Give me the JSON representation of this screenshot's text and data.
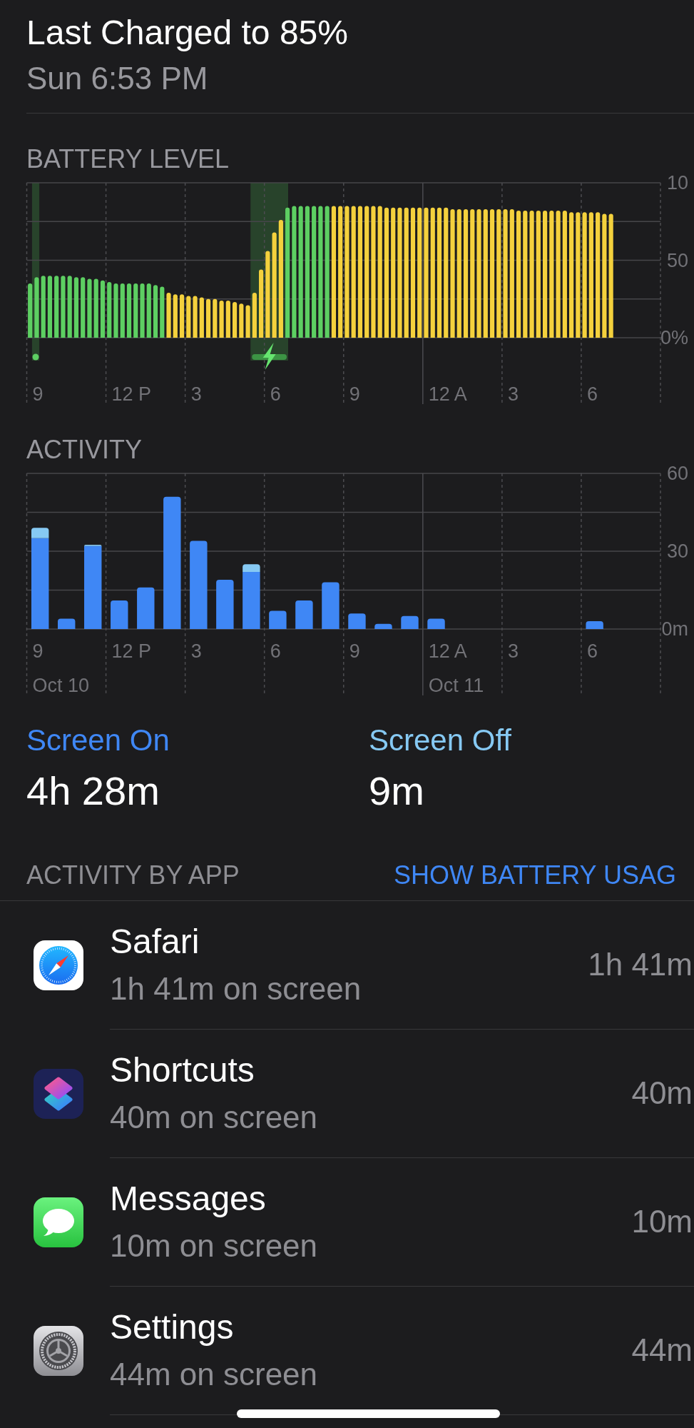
{
  "header": {
    "title": "Last Charged to 85%",
    "subtitle": "Sun 6:53 PM"
  },
  "battery_level": {
    "heading": "BATTERY LEVEL",
    "y_top_label": "10",
    "x_labels": [
      {
        "label": "9"
      },
      {
        "label": "12 P"
      },
      {
        "label": "3"
      },
      {
        "label": "6"
      },
      {
        "label": "9"
      },
      {
        "label": "12 A"
      },
      {
        "label": "3"
      },
      {
        "label": "6"
      }
    ],
    "chart_data": {
      "type": "bar",
      "ylim": [
        0,
        100
      ],
      "yticks": [
        {
          "value": 0,
          "label": "0%"
        },
        50
      ],
      "series": [
        {
          "color": "#5dcf62",
          "values": [
            35,
            39,
            40,
            40,
            40,
            40,
            40,
            39,
            39,
            38,
            38,
            37,
            36,
            35,
            35,
            35,
            35,
            35,
            35,
            34,
            33,
            null,
            null,
            null,
            null,
            null,
            null,
            null,
            null,
            null,
            null,
            null,
            null,
            null,
            null,
            null,
            null,
            null,
            null,
            84,
            85,
            85,
            85,
            85,
            85,
            85,
            null,
            null,
            null,
            null,
            null,
            null,
            null,
            null,
            null,
            null,
            null,
            null,
            null,
            null,
            null,
            null,
            null,
            null,
            null,
            null,
            null,
            null,
            null,
            null,
            null,
            null,
            null,
            null,
            null,
            null,
            null,
            null,
            null,
            null,
            null,
            null,
            null,
            null,
            null,
            null,
            null,
            null,
            null,
            null,
            null,
            null,
            null,
            null,
            null,
            null
          ]
        },
        {
          "color": "#f4d13d",
          "values": [
            null,
            null,
            null,
            null,
            null,
            null,
            null,
            null,
            null,
            null,
            null,
            null,
            null,
            null,
            null,
            null,
            null,
            null,
            null,
            null,
            null,
            29,
            28,
            28,
            27,
            27,
            26,
            25,
            25,
            24,
            24,
            23,
            22,
            21,
            29,
            44,
            56,
            68,
            76,
            null,
            null,
            null,
            null,
            null,
            null,
            null,
            85,
            85,
            85,
            85,
            85,
            85,
            85,
            85,
            84,
            84,
            84,
            84,
            84,
            84,
            84,
            84,
            84,
            84,
            83,
            83,
            83,
            83,
            83,
            83,
            83,
            83,
            83,
            83,
            82,
            82,
            82,
            82,
            82,
            82,
            82,
            82,
            81,
            81,
            81,
            81,
            81,
            80,
            80,
            null,
            null,
            null,
            null,
            null,
            null,
            null
          ]
        }
      ]
    }
  },
  "activity": {
    "heading": "ACTIVITY",
    "x_labels": [
      {
        "label": "9",
        "date": "Oct 10"
      },
      {
        "label": "12 P"
      },
      {
        "label": "3"
      },
      {
        "label": "6"
      },
      {
        "label": "9"
      },
      {
        "label": "12 A",
        "date": "Oct 11"
      },
      {
        "label": "3"
      },
      {
        "label": "6"
      }
    ],
    "chart_data": {
      "type": "bar",
      "stacked": true,
      "ylim": [
        0,
        60
      ],
      "yticks": [
        {
          "value": 0,
          "label": "0m"
        },
        30,
        60
      ],
      "series": [
        {
          "color": "#3f87f5",
          "values": [
            35,
            4,
            32,
            11,
            16,
            51,
            34,
            19,
            22,
            7,
            11,
            18,
            6,
            2,
            5,
            4,
            null,
            null,
            null,
            null,
            null,
            3,
            null,
            null
          ]
        },
        {
          "color": "#86c9f3",
          "values": [
            4,
            null,
            0.5,
            null,
            null,
            null,
            null,
            null,
            3,
            null,
            null,
            null,
            null,
            null,
            null,
            null,
            null,
            null,
            null,
            null,
            null,
            null,
            null,
            null
          ]
        }
      ]
    }
  },
  "summary": [
    {
      "label": "Screen On",
      "value": "4h 28m",
      "color": "#3f87f5"
    },
    {
      "label": "Screen Off",
      "value": "9m",
      "color": "#86c9f3"
    }
  ],
  "apps": {
    "heading": "ACTIVITY BY APP",
    "link": "SHOW BATTERY USAG",
    "items": [
      {
        "name": "Safari",
        "detail": "1h 41m on screen",
        "time": "1h 41m"
      },
      {
        "name": "Shortcuts",
        "detail": "40m on screen",
        "time": "40m"
      },
      {
        "name": "Messages",
        "detail": "10m on screen",
        "time": "10m"
      },
      {
        "name": "Settings",
        "detail": "44m on screen",
        "time": "44m"
      }
    ]
  }
}
